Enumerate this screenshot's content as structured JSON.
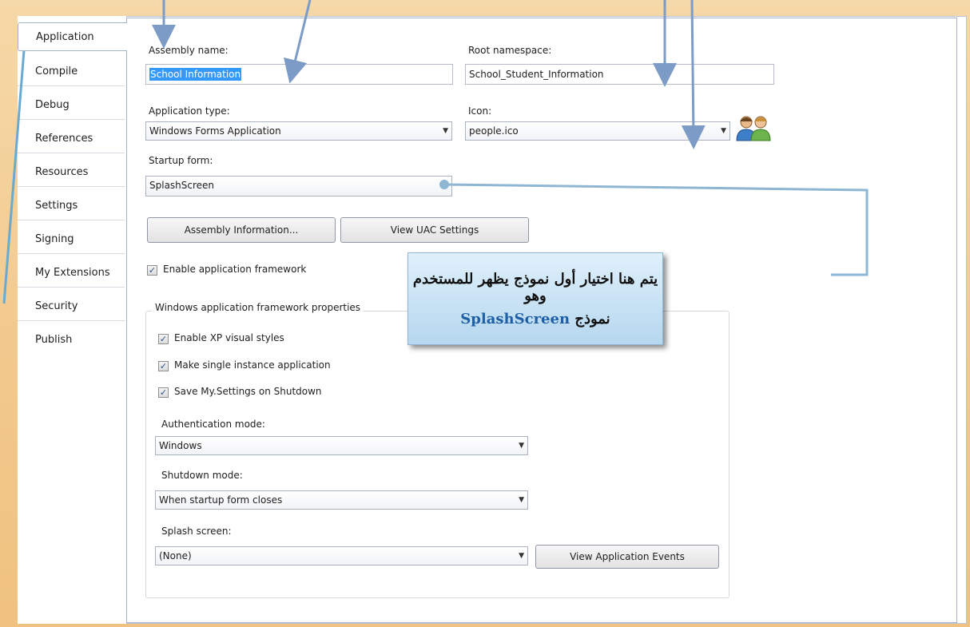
{
  "tabs": [
    "Application",
    "Compile",
    "Debug",
    "References",
    "Resources",
    "Settings",
    "Signing",
    "My Extensions",
    "Security",
    "Publish"
  ],
  "assembly": {
    "label": "Assembly name:",
    "value": "School Information"
  },
  "root_namespace": {
    "label": "Root namespace:",
    "value": "School_Student_Information"
  },
  "app_type": {
    "label": "Application type:",
    "value": "Windows Forms Application"
  },
  "icon": {
    "label": "Icon:",
    "value": "people.ico",
    "icon_name": "people-icon"
  },
  "startup_form": {
    "label": "Startup form:",
    "value": "SplashScreen"
  },
  "buttons": {
    "assembly_info": "Assembly Information...",
    "uac": "View UAC Settings",
    "app_events": "View Application Events"
  },
  "enable_framework": {
    "label": "Enable application framework",
    "checked": true
  },
  "framework": {
    "legend": "Windows application framework properties",
    "xp_styles": "Enable XP visual styles",
    "single_instance": "Make single instance application",
    "save_settings": "Save My.Settings on Shutdown",
    "auth_label": "Authentication mode:",
    "auth_value": "Windows",
    "shutdown_label": "Shutdown mode:",
    "shutdown_value": "When startup form closes",
    "splash_label": "Splash screen:",
    "splash_value": "(None)"
  },
  "callout": {
    "line1": "يتم هنا اختيار أول نموذج يظهر للمستخدم وهو",
    "line2_prefix": "نموذج",
    "line2_accent": "SplashScreen"
  },
  "colors": {
    "tab_border": "#a6b1c6",
    "callout_bg": "#c8e2f4",
    "arrow": "#6f94c2",
    "callout_accent": "#1f5fa6"
  }
}
